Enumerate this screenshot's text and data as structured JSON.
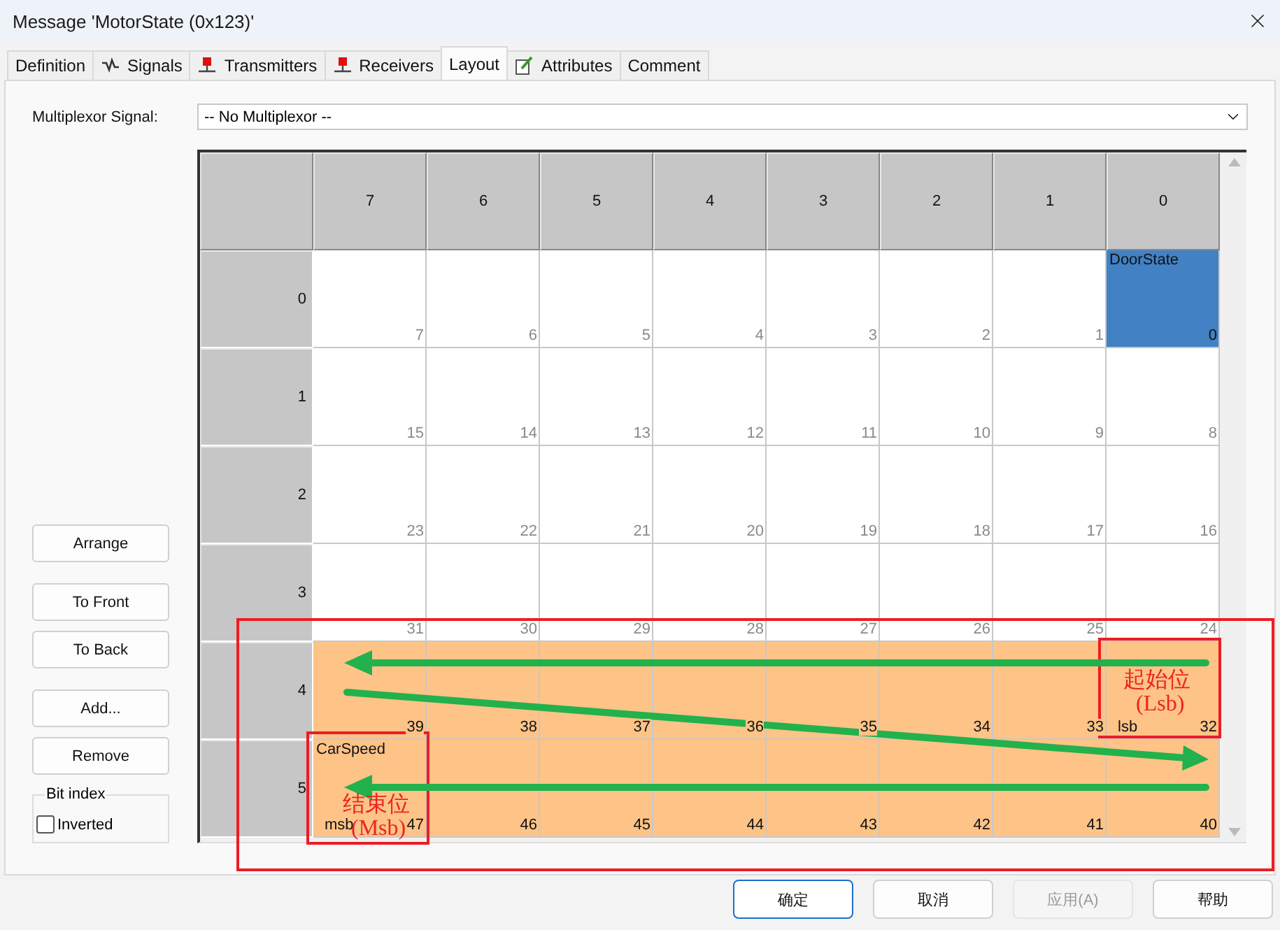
{
  "window": {
    "title": "Message 'MotorState (0x123)'"
  },
  "tabs": [
    {
      "label": "Definition",
      "selected": false
    },
    {
      "label": "Signals",
      "selected": false
    },
    {
      "label": "Transmitters",
      "selected": false
    },
    {
      "label": "Receivers",
      "selected": false
    },
    {
      "label": "Layout",
      "selected": true
    },
    {
      "label": "Attributes",
      "selected": false
    },
    {
      "label": "Comment",
      "selected": false
    }
  ],
  "multiplexor": {
    "label": "Multiplexor Signal:",
    "value": "-- No Multiplexor --"
  },
  "side_buttons": [
    [
      "Arrange"
    ],
    [
      "To Front",
      "To Back"
    ],
    [
      "Add...",
      "Remove"
    ]
  ],
  "bit_index": {
    "title": "Bit index",
    "inverted": {
      "label": "Inverted",
      "checked": false
    }
  },
  "layout": {
    "columns": [
      "7",
      "6",
      "5",
      "4",
      "3",
      "2",
      "1",
      "0"
    ],
    "rows": [
      {
        "label": "0",
        "cells": [
          {
            "bit": "7"
          },
          {
            "bit": "6"
          },
          {
            "bit": "5"
          },
          {
            "bit": "4"
          },
          {
            "bit": "3"
          },
          {
            "bit": "2"
          },
          {
            "bit": "1"
          },
          {
            "bit": "0",
            "color": "#4181c4",
            "name": "DoorState"
          }
        ]
      },
      {
        "label": "1",
        "cells": [
          {
            "bit": "15"
          },
          {
            "bit": "14"
          },
          {
            "bit": "13"
          },
          {
            "bit": "12"
          },
          {
            "bit": "11"
          },
          {
            "bit": "10"
          },
          {
            "bit": "9"
          },
          {
            "bit": "8"
          }
        ]
      },
      {
        "label": "2",
        "cells": [
          {
            "bit": "23"
          },
          {
            "bit": "22"
          },
          {
            "bit": "21"
          },
          {
            "bit": "20"
          },
          {
            "bit": "19"
          },
          {
            "bit": "18"
          },
          {
            "bit": "17"
          },
          {
            "bit": "16"
          }
        ]
      },
      {
        "label": "3",
        "cells": [
          {
            "bit": "31"
          },
          {
            "bit": "30"
          },
          {
            "bit": "29"
          },
          {
            "bit": "28"
          },
          {
            "bit": "27"
          },
          {
            "bit": "26"
          },
          {
            "bit": "25"
          },
          {
            "bit": "24"
          }
        ]
      },
      {
        "label": "4",
        "cells": [
          {
            "bit": "39",
            "color": "#fdc387"
          },
          {
            "bit": "38",
            "color": "#fdc387"
          },
          {
            "bit": "37",
            "color": "#fdc387"
          },
          {
            "bit": "36",
            "color": "#fdc387"
          },
          {
            "bit": "35",
            "color": "#fdc387"
          },
          {
            "bit": "34",
            "color": "#fdc387"
          },
          {
            "bit": "33",
            "color": "#fdc387"
          },
          {
            "bit": "32",
            "color": "#fdc387",
            "marker": "lsb"
          }
        ]
      },
      {
        "label": "5",
        "cells": [
          {
            "bit": "47",
            "color": "#fdc387",
            "name": "CarSpeed",
            "marker": "msb"
          },
          {
            "bit": "46",
            "color": "#fdc387"
          },
          {
            "bit": "45",
            "color": "#fdc387"
          },
          {
            "bit": "44",
            "color": "#fdc387"
          },
          {
            "bit": "43",
            "color": "#fdc387"
          },
          {
            "bit": "42",
            "color": "#fdc387"
          },
          {
            "bit": "41",
            "color": "#fdc387"
          },
          {
            "bit": "40",
            "color": "#fdc387"
          }
        ]
      }
    ]
  },
  "annotations": [
    {
      "title": "起始位",
      "note": "(Lsb)"
    },
    {
      "title": "结束位",
      "note": "(Msb)"
    }
  ],
  "buttons": [
    {
      "label": "确定",
      "default": true,
      "disabled": false
    },
    {
      "label": "取消",
      "default": false,
      "disabled": false
    },
    {
      "label": "应用(A)",
      "default": false,
      "disabled": true
    },
    {
      "label": "帮助",
      "default": false,
      "disabled": false
    }
  ]
}
